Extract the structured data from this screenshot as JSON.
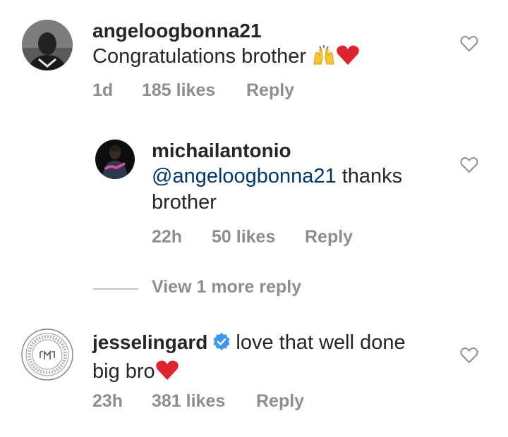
{
  "comments": [
    {
      "username": "angeloogbonna21",
      "text": "Congratulations brother",
      "emojis": [
        "raising-hands-emoji",
        "red-heart-emoji"
      ],
      "age": "1d",
      "likes": "185 likes",
      "reply": "Reply"
    },
    {
      "username": "michailantonio",
      "mention": "@angeloogbonna21",
      "text_line1": " thanks",
      "text_line2": "brother",
      "age": "22h",
      "likes": "50 likes",
      "reply": "Reply"
    },
    {
      "username": "jesselingard",
      "verified_icon": "verified-badge-icon",
      "text_line1": "love that well done",
      "text_line2": "big bro",
      "emojis": [
        "red-heart-emoji"
      ],
      "age": "23h",
      "likes": "381 likes",
      "reply": "Reply"
    }
  ],
  "view_more_replies": "View 1 more reply",
  "colors": {
    "text": "#262626",
    "meta": "#8e8e8e",
    "mention": "#00376b",
    "verified": "#3897f0",
    "heart_emoji": "#e0242f"
  }
}
